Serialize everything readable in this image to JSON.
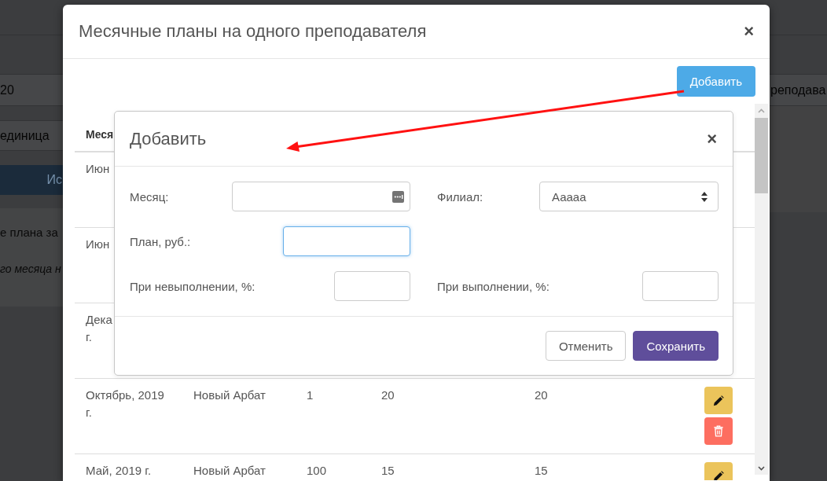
{
  "background_page": {
    "value_text": "20",
    "side_text": "реподава",
    "field_value": "единица",
    "button_label": "Ис",
    "heading": "е плана за",
    "note": "го месяца н"
  },
  "plans_dialog": {
    "title": "Месячные планы на одного преподавателя",
    "close": "×",
    "add_button": "Добавить",
    "table": {
      "columns": [
        "Меся"
      ],
      "rows": [
        {
          "kind": "covered",
          "month": "Июн"
        },
        {
          "kind": "covered",
          "month": "Июн"
        },
        {
          "kind": "covered",
          "month": "Дека г."
        },
        {
          "kind": "full",
          "month": "Октябрь, 2019 г.",
          "branch": "Новый Арбат",
          "column_3": "1",
          "column_4": "20",
          "column_5": "20",
          "actions": [
            {
              "kind": "edit"
            },
            {
              "kind": "delete"
            }
          ]
        },
        {
          "kind": "full",
          "month": "Май, 2019 г.",
          "branch": "Новый Арбат",
          "column_3": "100",
          "column_4": "15",
          "column_5": "15",
          "actions": [
            {
              "kind": "edit"
            }
          ]
        }
      ]
    }
  },
  "add_dialog": {
    "title": "Добавить",
    "close": "×",
    "fields": [
      {
        "kind": "date",
        "label": "Месяц:",
        "focused": false
      },
      {
        "kind": "select",
        "label": "Филиал:",
        "value": "Ааааа",
        "focused": false
      },
      {
        "kind": "money",
        "label": "План, руб.:",
        "focused": true
      },
      {
        "kind": "percent",
        "label": "При невыполнении, %:",
        "focused": false
      },
      {
        "kind": "percent",
        "label": "При выполнении, %:",
        "focused": false
      }
    ],
    "buttons": [
      {
        "kind": "default",
        "label": "Отменить"
      },
      {
        "kind": "primary",
        "label": "Сохранить"
      }
    ]
  }
}
